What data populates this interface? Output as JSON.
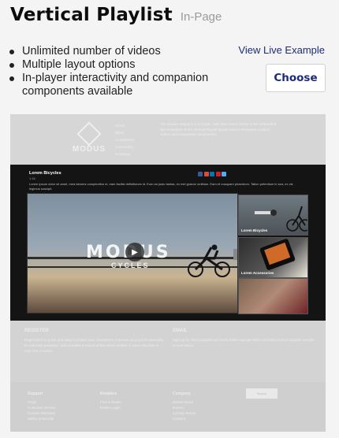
{
  "header": {
    "title": "Vertical Playlist",
    "tag": "In-Page"
  },
  "features": [
    "Unlimited number of videos",
    "Multiple layout options",
    "In-player interactivity and companion components available"
  ],
  "actions": {
    "live_example": "View Live Example",
    "choose": "Choose"
  },
  "preview": {
    "logo_text": "MODUS",
    "nav_items": [
      "Home",
      "Bikes",
      "Accessories",
      "Community",
      "Company"
    ],
    "intro": "The Modus company is a simple, bold bike brand. Below is the embedded demonstration of the Vertical Playlist layout used to showcase product videos and companion components.",
    "video_title": "Lorem Bicycles",
    "video_sub": "1:16",
    "video_desc": "Lorem ipsum dolor sit amet, mea labores complectitur ei, eam facilisi definitiones id. Eum an justo tantas, ex mel graece omittam. Eam et nusquam phaedrum. Tation petentium in sea, ex vis legimus suscipit.",
    "player_brand": "MODUS",
    "player_brand_sub": "CYCLES",
    "thumbs": [
      {
        "label": "Lorem Bicycles"
      },
      {
        "label": "Lorem Accessories"
      },
      {
        "label": ""
      }
    ],
    "register_title": "REGISTER",
    "register_text": "Registration is quick and easy to protect your investment. It serves as proof of ownership for warranty purposes, and provides a record of the serial number in case your bike is ever lost or stolen.",
    "email_title": "EMAIL",
    "email_text": "Sign up for email updates and we'll deliver special offers and new product updates straight to your inbox.",
    "footer_cols": [
      {
        "title": "Support",
        "items": [
          "FAQs",
          "Customer Service",
          "Contact Warranty",
          "Safety & Recalls"
        ]
      },
      {
        "title": "Retailers",
        "items": [
          "Find a Dealer",
          "Dealer Login"
        ]
      },
      {
        "title": "Company",
        "items": [
          "Modus News",
          "Events",
          "Cycling Teams",
          "Careers"
        ]
      }
    ],
    "search_placeholder": "Search",
    "colors": {
      "social": [
        "#3b5998",
        "#dd4b39",
        "#0077b5",
        "#cb2027",
        "#55acee"
      ]
    }
  }
}
